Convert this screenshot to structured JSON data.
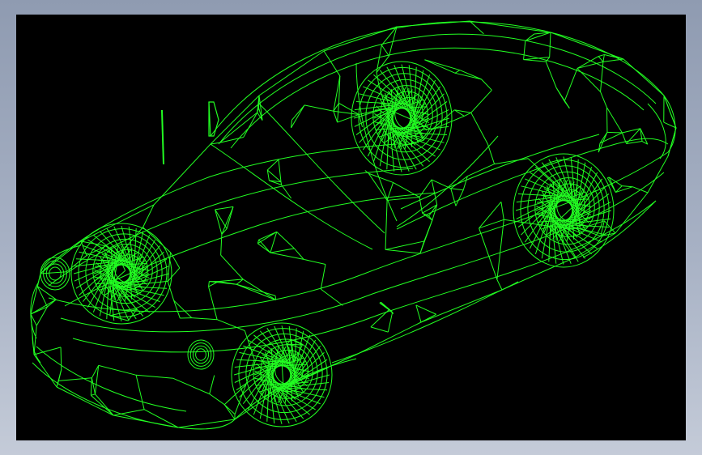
{
  "window": {
    "background_top": "#8f9bb1",
    "background_bottom": "#c4cbd8"
  },
  "viewport": {
    "background": "#000000",
    "wire_color": "#22ff22",
    "model": "car-wireframe"
  }
}
